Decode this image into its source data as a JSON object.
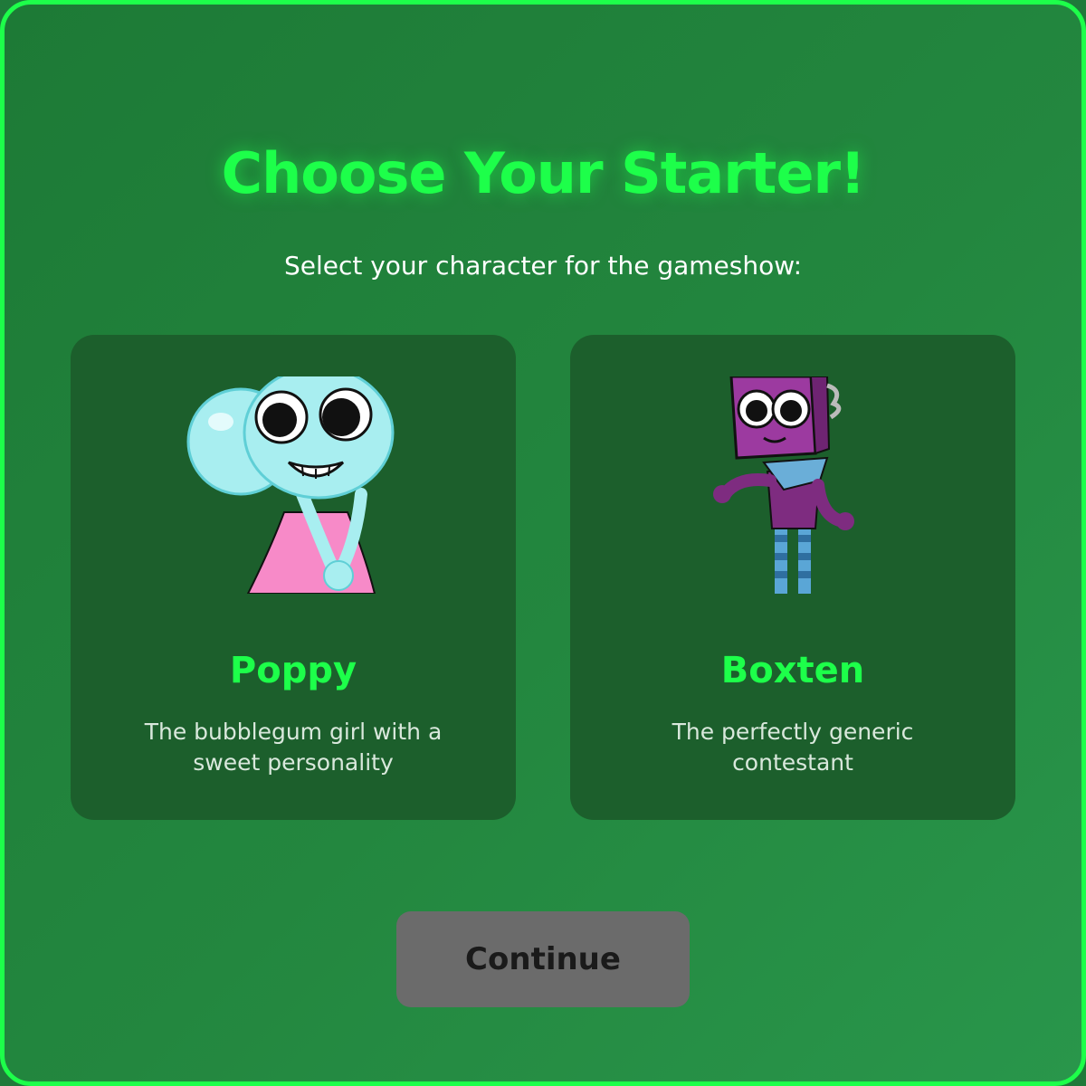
{
  "header": {
    "title": "Choose Your Starter!",
    "subtitle": "Select your character for the gameshow:"
  },
  "characters": [
    {
      "name": "Poppy",
      "description": "The bubblegum girl with a sweet personality",
      "portrait": "poppy-character-image"
    },
    {
      "name": "Boxten",
      "description": "The perfectly generic contestant",
      "portrait": "boxten-character-image"
    }
  ],
  "actions": {
    "continue_label": "Continue"
  },
  "colors": {
    "accent": "#1dff4a",
    "background": "#23873f",
    "card": "#1c5f2c",
    "button_disabled": "#6b6b6b"
  }
}
